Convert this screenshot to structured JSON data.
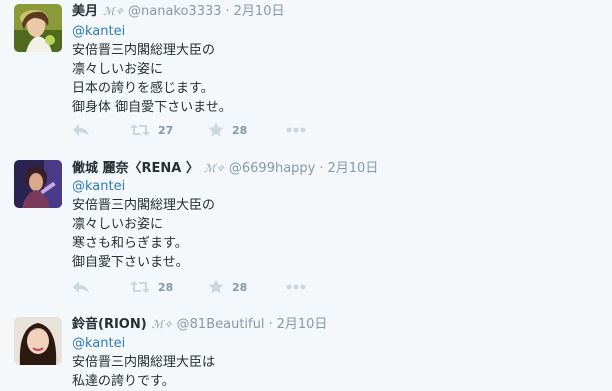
{
  "tweets": [
    {
      "name": "美月",
      "mark": "ℳ✧",
      "handle": "@nanako3333",
      "separator": "·",
      "time": "2月10日",
      "mention": "@kantei",
      "lines": [
        "安倍晋三内閣総理大臣の",
        "凛々しいお姿に",
        "日本の誇りを感じます。",
        "御身体 御自愛下さいませ。"
      ],
      "retweets": "27",
      "favorites": "28"
    },
    {
      "name": "僘城 麗奈〈RENA 〉",
      "mark": "ℳ✧",
      "handle": "@6699happy",
      "separator": "·",
      "time": "2月10日",
      "mention": "@kantei",
      "lines": [
        "安倍晋三内閣総理大臣の",
        "凛々しいお姿に",
        "寒さも和らぎます。",
        "御自愛下さいませ。"
      ],
      "retweets": "28",
      "favorites": "28"
    },
    {
      "name": "鈴音(RION)",
      "mark": "ℳ✧",
      "handle": "@81Beautiful",
      "separator": "·",
      "time": "2月10日",
      "mention": "@kantei",
      "lines": [
        "安倍晋三内閣総理大臣は",
        "私達の誇りです。"
      ]
    }
  ],
  "colors": {
    "link": "#2b7bb9",
    "muted": "#8899a6",
    "background": "#f5f8fa",
    "border": "#e1e8ed"
  },
  "icons": [
    "reply-icon",
    "retweet-icon",
    "favorite-icon",
    "more-icon"
  ]
}
